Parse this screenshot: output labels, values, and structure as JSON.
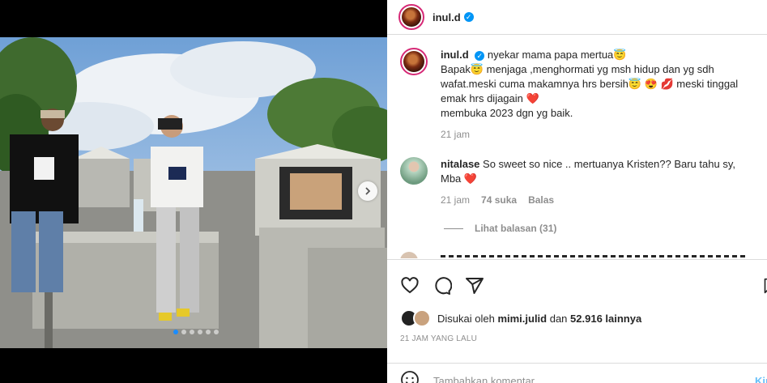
{
  "post": {
    "username": "inul.d",
    "verified": true,
    "caption_line1": "nyekar mama papa mertua😇",
    "caption_line2": "Bapak😇 menjaga ,menghormati yg msh hidup dan yg sdh",
    "caption_line3": "wafat.meski cuma makamnya hrs bersih😇 😍 💋 meski tinggal",
    "caption_line4": "emak hrs dijagain ❤️",
    "caption_line5": "membuka 2023 dgn yg baik.",
    "caption_time": "21 jam"
  },
  "comment": {
    "username": "nitalase",
    "text_line1": "So sweet so nice .. mertuanya Kristen?? Baru tahu sy,",
    "text_line2": "Mba ❤️",
    "time": "21 jam",
    "likes": "74 suka",
    "reply": "Balas",
    "view_replies": "Lihat balasan (31)"
  },
  "likes": {
    "prefix": "Disukai oleh ",
    "user": "mimi.julid",
    "middle": " dan ",
    "count": "52.916 lainnya"
  },
  "timestamp": "21 JAM YANG LALU",
  "comment_input": {
    "placeholder": "Tambahkan komentar...",
    "post_label": "Kirim"
  },
  "carousel": {
    "slide_count": 6,
    "active_index": 0
  },
  "colors": {
    "accent": "#0095f6",
    "heart": "#ed4956"
  }
}
